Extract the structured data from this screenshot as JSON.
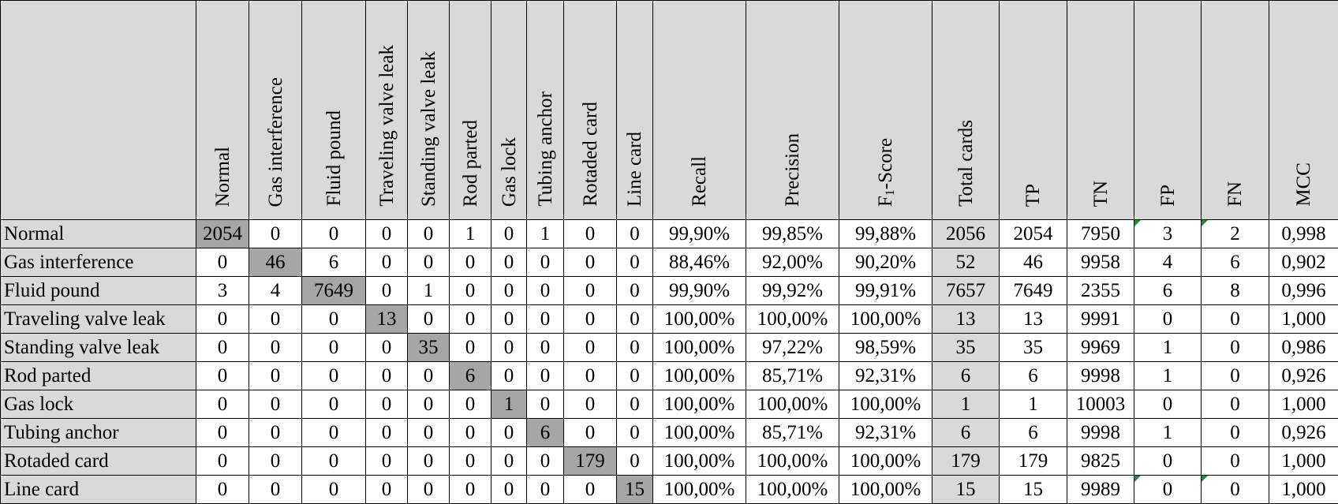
{
  "table": {
    "class_names": [
      "Normal",
      "Gas interference",
      "Fluid pound",
      "Traveling valve leak",
      "Standing valve leak",
      "Rod parted",
      "Gas lock",
      "Tubing anchor",
      "Rotaded card",
      "Line card"
    ],
    "metric_headers": {
      "recall": "Recall",
      "precision": "Precision",
      "f1_main": "F",
      "f1_sub": "1",
      "f1_suffix": "-Score",
      "total": "Total cards",
      "tp": "TP",
      "tn": "TN",
      "fp": "FP",
      "fn": "FN",
      "mcc": "MCC"
    },
    "rows": [
      {
        "label": "Normal",
        "cells": [
          "2054",
          "0",
          "0",
          "0",
          "0",
          "1",
          "0",
          "1",
          "0",
          "0"
        ],
        "recall": "99,90%",
        "precision": "99,85%",
        "f1": "99,88%",
        "total": "2056",
        "tp": "2054",
        "tn": "7950",
        "fp": "3",
        "fn": "2",
        "mcc": "0,998"
      },
      {
        "label": "Gas interference",
        "cells": [
          "0",
          "46",
          "6",
          "0",
          "0",
          "0",
          "0",
          "0",
          "0",
          "0"
        ],
        "recall": "88,46%",
        "precision": "92,00%",
        "f1": "90,20%",
        "total": "52",
        "tp": "46",
        "tn": "9958",
        "fp": "4",
        "fn": "6",
        "mcc": "0,902"
      },
      {
        "label": "Fluid pound",
        "cells": [
          "3",
          "4",
          "7649",
          "0",
          "1",
          "0",
          "0",
          "0",
          "0",
          "0"
        ],
        "recall": "99,90%",
        "precision": "99,92%",
        "f1": "99,91%",
        "total": "7657",
        "tp": "7649",
        "tn": "2355",
        "fp": "6",
        "fn": "8",
        "mcc": "0,996"
      },
      {
        "label": "Traveling valve leak",
        "cells": [
          "0",
          "0",
          "0",
          "13",
          "0",
          "0",
          "0",
          "0",
          "0",
          "0"
        ],
        "recall": "100,00%",
        "precision": "100,00%",
        "f1": "100,00%",
        "total": "13",
        "tp": "13",
        "tn": "9991",
        "fp": "0",
        "fn": "0",
        "mcc": "1,000"
      },
      {
        "label": "Standing valve leak",
        "cells": [
          "0",
          "0",
          "0",
          "0",
          "35",
          "0",
          "0",
          "0",
          "0",
          "0"
        ],
        "recall": "100,00%",
        "precision": "97,22%",
        "f1": "98,59%",
        "total": "35",
        "tp": "35",
        "tn": "9969",
        "fp": "1",
        "fn": "0",
        "mcc": "0,986"
      },
      {
        "label": "Rod parted",
        "cells": [
          "0",
          "0",
          "0",
          "0",
          "0",
          "6",
          "0",
          "0",
          "0",
          "0"
        ],
        "recall": "100,00%",
        "precision": "85,71%",
        "f1": "92,31%",
        "total": "6",
        "tp": "6",
        "tn": "9998",
        "fp": "1",
        "fn": "0",
        "mcc": "0,926"
      },
      {
        "label": "Gas lock",
        "cells": [
          "0",
          "0",
          "0",
          "0",
          "0",
          "0",
          "1",
          "0",
          "0",
          "0"
        ],
        "recall": "100,00%",
        "precision": "100,00%",
        "f1": "100,00%",
        "total": "1",
        "tp": "1",
        "tn": "10003",
        "fp": "0",
        "fn": "0",
        "mcc": "1,000"
      },
      {
        "label": "Tubing anchor",
        "cells": [
          "0",
          "0",
          "0",
          "0",
          "0",
          "0",
          "0",
          "6",
          "0",
          "0"
        ],
        "recall": "100,00%",
        "precision": "85,71%",
        "f1": "92,31%",
        "total": "6",
        "tp": "6",
        "tn": "9998",
        "fp": "1",
        "fn": "0",
        "mcc": "0,926"
      },
      {
        "label": "Rotaded card",
        "cells": [
          "0",
          "0",
          "0",
          "0",
          "0",
          "0",
          "0",
          "0",
          "179",
          "0"
        ],
        "recall": "100,00%",
        "precision": "100,00%",
        "f1": "100,00%",
        "total": "179",
        "tp": "179",
        "tn": "9825",
        "fp": "0",
        "fn": "0",
        "mcc": "1,000"
      },
      {
        "label": "Line card",
        "cells": [
          "0",
          "0",
          "0",
          "0",
          "0",
          "0",
          "0",
          "0",
          "0",
          "15"
        ],
        "recall": "100,00%",
        "precision": "100,00%",
        "f1": "100,00%",
        "total": "15",
        "tp": "15",
        "tn": "9989",
        "fp": "0",
        "fn": "0",
        "mcc": "1,000"
      }
    ],
    "marker_color": "#1e8a3c",
    "header_fill": "#d9d9d9",
    "diagonal_fill": "#a6a6a6"
  }
}
